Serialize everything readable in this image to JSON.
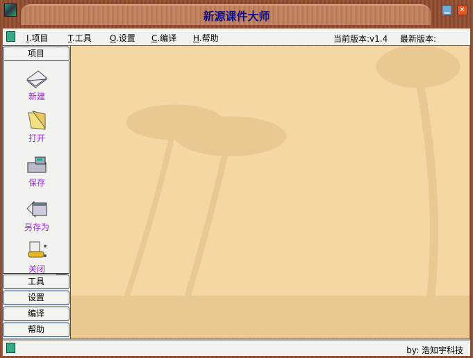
{
  "window": {
    "title": "新源课件大师"
  },
  "menu": {
    "items": [
      {
        "key": "I",
        "label": "项目"
      },
      {
        "key": "T",
        "label": "工具"
      },
      {
        "key": "O",
        "label": "设置"
      },
      {
        "key": "C",
        "label": "编译"
      },
      {
        "key": "H",
        "label": "帮助"
      }
    ],
    "current_version_label": "当前版本:v1.4",
    "latest_version_label": "最新版本:"
  },
  "sidebar": {
    "sections": [
      "项目",
      "工具",
      "设置",
      "编译",
      "帮助"
    ],
    "tools": [
      {
        "label": "新建",
        "icon": "new-icon"
      },
      {
        "label": "打开",
        "icon": "folder-open-icon"
      },
      {
        "label": "保存",
        "icon": "fax-save-icon"
      },
      {
        "label": "另存为",
        "icon": "save-as-window-icon"
      },
      {
        "label": "关闭",
        "icon": "close-clamp-icon"
      }
    ]
  },
  "status": {
    "credit": "by: 浩知宇科技"
  }
}
